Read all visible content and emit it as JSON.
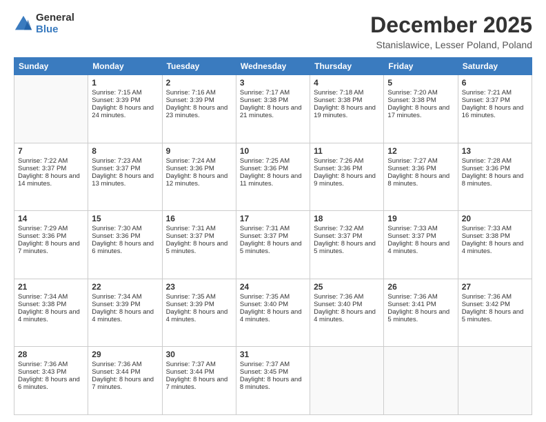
{
  "logo": {
    "general": "General",
    "blue": "Blue"
  },
  "title": "December 2025",
  "subtitle": "Stanislawice, Lesser Poland, Poland",
  "days_of_week": [
    "Sunday",
    "Monday",
    "Tuesday",
    "Wednesday",
    "Thursday",
    "Friday",
    "Saturday"
  ],
  "weeks": [
    [
      {
        "day": "",
        "sunrise": "",
        "sunset": "",
        "daylight": ""
      },
      {
        "day": "1",
        "sunrise": "Sunrise: 7:15 AM",
        "sunset": "Sunset: 3:39 PM",
        "daylight": "Daylight: 8 hours and 24 minutes."
      },
      {
        "day": "2",
        "sunrise": "Sunrise: 7:16 AM",
        "sunset": "Sunset: 3:39 PM",
        "daylight": "Daylight: 8 hours and 23 minutes."
      },
      {
        "day": "3",
        "sunrise": "Sunrise: 7:17 AM",
        "sunset": "Sunset: 3:38 PM",
        "daylight": "Daylight: 8 hours and 21 minutes."
      },
      {
        "day": "4",
        "sunrise": "Sunrise: 7:18 AM",
        "sunset": "Sunset: 3:38 PM",
        "daylight": "Daylight: 8 hours and 19 minutes."
      },
      {
        "day": "5",
        "sunrise": "Sunrise: 7:20 AM",
        "sunset": "Sunset: 3:38 PM",
        "daylight": "Daylight: 8 hours and 17 minutes."
      },
      {
        "day": "6",
        "sunrise": "Sunrise: 7:21 AM",
        "sunset": "Sunset: 3:37 PM",
        "daylight": "Daylight: 8 hours and 16 minutes."
      }
    ],
    [
      {
        "day": "7",
        "sunrise": "Sunrise: 7:22 AM",
        "sunset": "Sunset: 3:37 PM",
        "daylight": "Daylight: 8 hours and 14 minutes."
      },
      {
        "day": "8",
        "sunrise": "Sunrise: 7:23 AM",
        "sunset": "Sunset: 3:37 PM",
        "daylight": "Daylight: 8 hours and 13 minutes."
      },
      {
        "day": "9",
        "sunrise": "Sunrise: 7:24 AM",
        "sunset": "Sunset: 3:36 PM",
        "daylight": "Daylight: 8 hours and 12 minutes."
      },
      {
        "day": "10",
        "sunrise": "Sunrise: 7:25 AM",
        "sunset": "Sunset: 3:36 PM",
        "daylight": "Daylight: 8 hours and 11 minutes."
      },
      {
        "day": "11",
        "sunrise": "Sunrise: 7:26 AM",
        "sunset": "Sunset: 3:36 PM",
        "daylight": "Daylight: 8 hours and 9 minutes."
      },
      {
        "day": "12",
        "sunrise": "Sunrise: 7:27 AM",
        "sunset": "Sunset: 3:36 PM",
        "daylight": "Daylight: 8 hours and 8 minutes."
      },
      {
        "day": "13",
        "sunrise": "Sunrise: 7:28 AM",
        "sunset": "Sunset: 3:36 PM",
        "daylight": "Daylight: 8 hours and 8 minutes."
      }
    ],
    [
      {
        "day": "14",
        "sunrise": "Sunrise: 7:29 AM",
        "sunset": "Sunset: 3:36 PM",
        "daylight": "Daylight: 8 hours and 7 minutes."
      },
      {
        "day": "15",
        "sunrise": "Sunrise: 7:30 AM",
        "sunset": "Sunset: 3:36 PM",
        "daylight": "Daylight: 8 hours and 6 minutes."
      },
      {
        "day": "16",
        "sunrise": "Sunrise: 7:31 AM",
        "sunset": "Sunset: 3:37 PM",
        "daylight": "Daylight: 8 hours and 5 minutes."
      },
      {
        "day": "17",
        "sunrise": "Sunrise: 7:31 AM",
        "sunset": "Sunset: 3:37 PM",
        "daylight": "Daylight: 8 hours and 5 minutes."
      },
      {
        "day": "18",
        "sunrise": "Sunrise: 7:32 AM",
        "sunset": "Sunset: 3:37 PM",
        "daylight": "Daylight: 8 hours and 5 minutes."
      },
      {
        "day": "19",
        "sunrise": "Sunrise: 7:33 AM",
        "sunset": "Sunset: 3:37 PM",
        "daylight": "Daylight: 8 hours and 4 minutes."
      },
      {
        "day": "20",
        "sunrise": "Sunrise: 7:33 AM",
        "sunset": "Sunset: 3:38 PM",
        "daylight": "Daylight: 8 hours and 4 minutes."
      }
    ],
    [
      {
        "day": "21",
        "sunrise": "Sunrise: 7:34 AM",
        "sunset": "Sunset: 3:38 PM",
        "daylight": "Daylight: 8 hours and 4 minutes."
      },
      {
        "day": "22",
        "sunrise": "Sunrise: 7:34 AM",
        "sunset": "Sunset: 3:39 PM",
        "daylight": "Daylight: 8 hours and 4 minutes."
      },
      {
        "day": "23",
        "sunrise": "Sunrise: 7:35 AM",
        "sunset": "Sunset: 3:39 PM",
        "daylight": "Daylight: 8 hours and 4 minutes."
      },
      {
        "day": "24",
        "sunrise": "Sunrise: 7:35 AM",
        "sunset": "Sunset: 3:40 PM",
        "daylight": "Daylight: 8 hours and 4 minutes."
      },
      {
        "day": "25",
        "sunrise": "Sunrise: 7:36 AM",
        "sunset": "Sunset: 3:40 PM",
        "daylight": "Daylight: 8 hours and 4 minutes."
      },
      {
        "day": "26",
        "sunrise": "Sunrise: 7:36 AM",
        "sunset": "Sunset: 3:41 PM",
        "daylight": "Daylight: 8 hours and 5 minutes."
      },
      {
        "day": "27",
        "sunrise": "Sunrise: 7:36 AM",
        "sunset": "Sunset: 3:42 PM",
        "daylight": "Daylight: 8 hours and 5 minutes."
      }
    ],
    [
      {
        "day": "28",
        "sunrise": "Sunrise: 7:36 AM",
        "sunset": "Sunset: 3:43 PM",
        "daylight": "Daylight: 8 hours and 6 minutes."
      },
      {
        "day": "29",
        "sunrise": "Sunrise: 7:36 AM",
        "sunset": "Sunset: 3:44 PM",
        "daylight": "Daylight: 8 hours and 7 minutes."
      },
      {
        "day": "30",
        "sunrise": "Sunrise: 7:37 AM",
        "sunset": "Sunset: 3:44 PM",
        "daylight": "Daylight: 8 hours and 7 minutes."
      },
      {
        "day": "31",
        "sunrise": "Sunrise: 7:37 AM",
        "sunset": "Sunset: 3:45 PM",
        "daylight": "Daylight: 8 hours and 8 minutes."
      },
      {
        "day": "",
        "sunrise": "",
        "sunset": "",
        "daylight": ""
      },
      {
        "day": "",
        "sunrise": "",
        "sunset": "",
        "daylight": ""
      },
      {
        "day": "",
        "sunrise": "",
        "sunset": "",
        "daylight": ""
      }
    ]
  ]
}
